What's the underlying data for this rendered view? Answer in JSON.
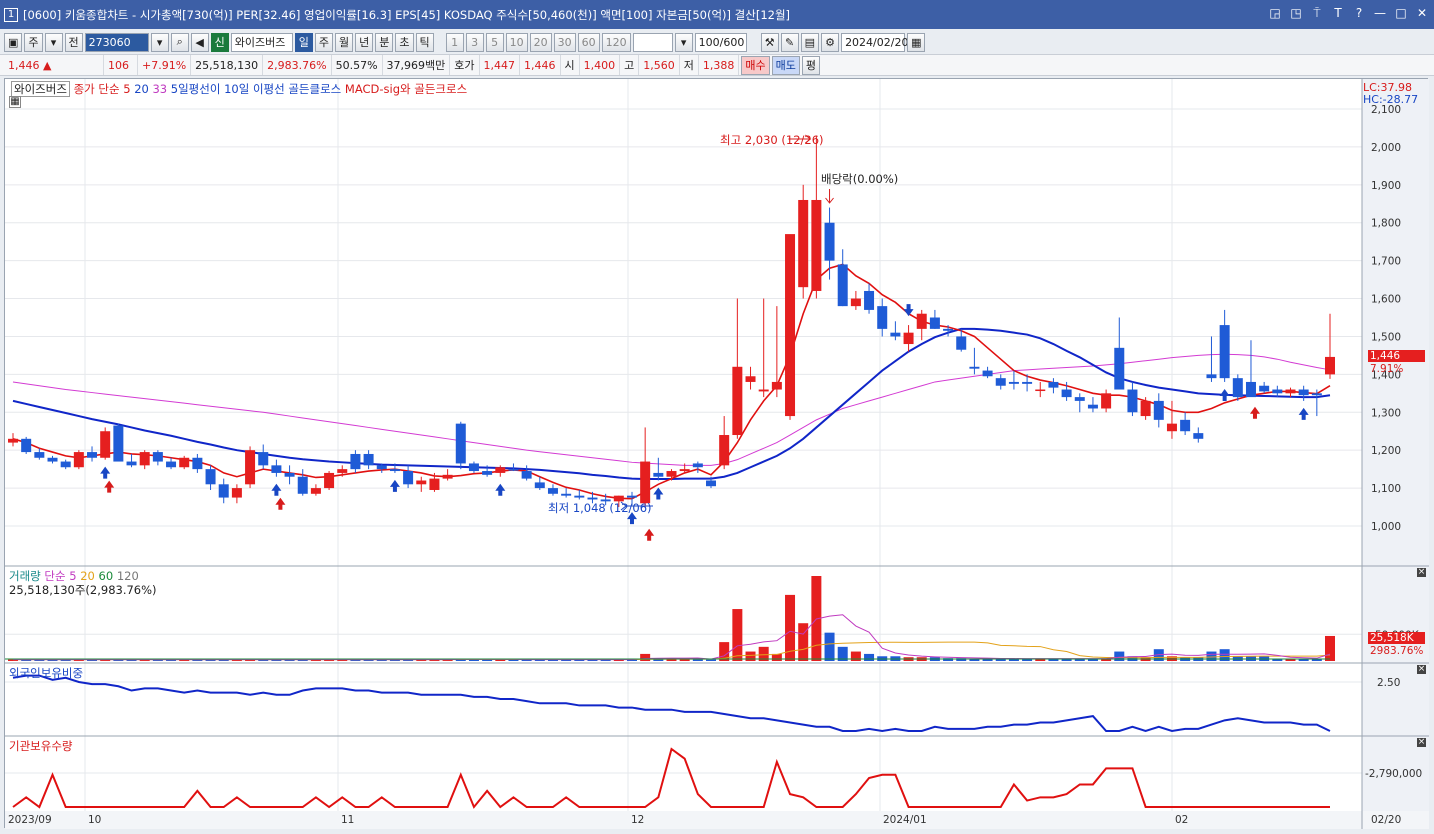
{
  "window": {
    "badge": "1",
    "title": "[0600] 키움종합차트 - 시가총액[730(억)] PER[32.46] 영업이익률[16.3] EPS[45] KOSDAQ 주식수[50,460(천)] 액면[100] 자본금[50(억)] 결산[12월]",
    "controls": [
      "◲",
      "◳",
      "⍑",
      "T",
      "?",
      "—",
      "□",
      "✕"
    ]
  },
  "toolbar": {
    "period": "주",
    "prev": "전",
    "code": "273060",
    "stock_name": "와이즈버즈",
    "new_badge": "신",
    "timeframes": [
      "일",
      "주",
      "월",
      "년",
      "분",
      "초",
      "틱"
    ],
    "selected_timeframe": "일",
    "intervals": [
      "1",
      "3",
      "5",
      "10",
      "20",
      "30",
      "60",
      "120"
    ],
    "count": "100/600",
    "date": "2024/02/20"
  },
  "quote": {
    "price": "1,446 ▲",
    "change": "106",
    "change_pct": "+7.91%",
    "volume": "25,518,130",
    "volume_pct": "2,983.76%",
    "ratio": "50.57%",
    "amount": "37,969백만",
    "ask_label": "호가",
    "ask": "1,447",
    "bid": "1,446",
    "open_label": "시",
    "open": "1,400",
    "high_label": "고",
    "high": "1,560",
    "low_label": "저",
    "low": "1,388",
    "buy_btn": "매수",
    "sell_btn": "매도",
    "eval_btn": "평"
  },
  "price_panel": {
    "legend_name": "와이즈버즈",
    "legend_ma": "종가 단순",
    "ma_periods": [
      "5",
      "20",
      "33"
    ],
    "legend_signal": "5일평선이 10일 이평선 골든클로스",
    "legend_macd": "MACD-sig와 골든크로스",
    "lc": "LC:37.98",
    "hc": "HC:-28.77",
    "max_annot": "최고 2,030 (12/26)",
    "min_annot": "최저 1,048 (12/06)",
    "div_annot": "배당락(0.00%)",
    "current_label": "1,446",
    "current_pct": "7.91%",
    "y_ticks": [
      "2,100",
      "2,000",
      "1,900",
      "1,800",
      "1,700",
      "1,600",
      "1,500",
      "1,400",
      "1,300",
      "1,200",
      "1,100",
      "1,000"
    ]
  },
  "volume_panel": {
    "title": "거래량",
    "ma_label": "단순",
    "ma_periods": [
      "5",
      "20",
      "60",
      "120"
    ],
    "info": "25,518,130주(2,983.76%)",
    "tick": "50,000K",
    "current_label": "25,518K",
    "current_pct": "2983.76%"
  },
  "foreign_panel": {
    "title": "외국인보유비중",
    "tick": "2.50"
  },
  "inst_panel": {
    "title": "기관보유수량",
    "tick": "-2,790,000"
  },
  "x_axis": [
    "2023/09",
    "10",
    "11",
    "12",
    "2024/01",
    "02",
    "02/20"
  ],
  "chart_data": {
    "type": "candlestick",
    "candles": [
      [
        1220,
        1245,
        1210,
        1230
      ],
      [
        1230,
        1235,
        1190,
        1195
      ],
      [
        1195,
        1205,
        1175,
        1180
      ],
      [
        1180,
        1185,
        1165,
        1170
      ],
      [
        1170,
        1175,
        1150,
        1155
      ],
      [
        1155,
        1200,
        1150,
        1195
      ],
      [
        1195,
        1210,
        1170,
        1180
      ],
      [
        1180,
        1260,
        1175,
        1250
      ],
      [
        1265,
        1270,
        1175,
        1170
      ],
      [
        1170,
        1190,
        1155,
        1160
      ],
      [
        1160,
        1200,
        1150,
        1195
      ],
      [
        1195,
        1200,
        1160,
        1170
      ],
      [
        1170,
        1180,
        1150,
        1155
      ],
      [
        1155,
        1185,
        1150,
        1180
      ],
      [
        1180,
        1190,
        1140,
        1150
      ],
      [
        1150,
        1160,
        1095,
        1110
      ],
      [
        1110,
        1125,
        1060,
        1075
      ],
      [
        1075,
        1110,
        1060,
        1100
      ],
      [
        1110,
        1210,
        1100,
        1200
      ],
      [
        1195,
        1215,
        1150,
        1160
      ],
      [
        1160,
        1175,
        1130,
        1140
      ],
      [
        1140,
        1160,
        1110,
        1130
      ],
      [
        1130,
        1150,
        1080,
        1085
      ],
      [
        1085,
        1110,
        1080,
        1100
      ],
      [
        1100,
        1145,
        1095,
        1140
      ],
      [
        1140,
        1160,
        1130,
        1150
      ],
      [
        1190,
        1200,
        1140,
        1150
      ],
      [
        1190,
        1200,
        1150,
        1160
      ],
      [
        1160,
        1165,
        1140,
        1150
      ],
      [
        1150,
        1165,
        1140,
        1145
      ],
      [
        1145,
        1160,
        1100,
        1110
      ],
      [
        1110,
        1130,
        1090,
        1120
      ],
      [
        1095,
        1140,
        1090,
        1125
      ],
      [
        1125,
        1150,
        1120,
        1135
      ],
      [
        1270,
        1275,
        1150,
        1165
      ],
      [
        1165,
        1170,
        1140,
        1145
      ],
      [
        1145,
        1160,
        1130,
        1135
      ],
      [
        1140,
        1160,
        1130,
        1155
      ],
      [
        1150,
        1165,
        1145,
        1148
      ],
      [
        1145,
        1160,
        1120,
        1125
      ],
      [
        1115,
        1130,
        1095,
        1100
      ],
      [
        1100,
        1110,
        1080,
        1085
      ],
      [
        1085,
        1100,
        1075,
        1080
      ],
      [
        1080,
        1095,
        1070,
        1075
      ],
      [
        1075,
        1090,
        1060,
        1070
      ],
      [
        1070,
        1085,
        1055,
        1065
      ],
      [
        1065,
        1080,
        1050,
        1080
      ],
      [
        1080,
        1090,
        1055,
        1075
      ],
      [
        1060,
        1260,
        1048,
        1170
      ],
      [
        1140,
        1180,
        1120,
        1130
      ],
      [
        1130,
        1150,
        1120,
        1145
      ],
      [
        1145,
        1165,
        1140,
        1150
      ],
      [
        1165,
        1170,
        1140,
        1155
      ],
      [
        1120,
        1130,
        1100,
        1105
      ],
      [
        1160,
        1290,
        1150,
        1240
      ],
      [
        1240,
        1600,
        1230,
        1420
      ],
      [
        1380,
        1420,
        1360,
        1395
      ],
      [
        1355,
        1600,
        1340,
        1360
      ],
      [
        1360,
        1580,
        1340,
        1380
      ],
      [
        1290,
        1680,
        1280,
        1770
      ],
      [
        1630,
        1900,
        1600,
        1860
      ],
      [
        1620,
        2030,
        1600,
        1860
      ],
      [
        1800,
        1840,
        1650,
        1700
      ],
      [
        1690,
        1730,
        1580,
        1580
      ],
      [
        1580,
        1620,
        1570,
        1600
      ],
      [
        1620,
        1640,
        1560,
        1570
      ],
      [
        1580,
        1600,
        1500,
        1520
      ],
      [
        1510,
        1540,
        1490,
        1500
      ],
      [
        1480,
        1530,
        1460,
        1510
      ],
      [
        1520,
        1570,
        1490,
        1560
      ],
      [
        1550,
        1570,
        1520,
        1520
      ],
      [
        1520,
        1530,
        1500,
        1515
      ],
      [
        1500,
        1520,
        1460,
        1465
      ],
      [
        1420,
        1470,
        1400,
        1415
      ],
      [
        1410,
        1420,
        1390,
        1395
      ],
      [
        1390,
        1400,
        1360,
        1370
      ],
      [
        1380,
        1410,
        1360,
        1375
      ],
      [
        1380,
        1400,
        1355,
        1375
      ],
      [
        1360,
        1380,
        1340,
        1360
      ],
      [
        1380,
        1390,
        1350,
        1365
      ],
      [
        1360,
        1380,
        1330,
        1340
      ],
      [
        1340,
        1350,
        1300,
        1330
      ],
      [
        1320,
        1340,
        1300,
        1310
      ],
      [
        1310,
        1360,
        1300,
        1350
      ],
      [
        1470,
        1550,
        1440,
        1360
      ],
      [
        1360,
        1380,
        1290,
        1300
      ],
      [
        1290,
        1340,
        1280,
        1330
      ],
      [
        1330,
        1350,
        1260,
        1280
      ],
      [
        1250,
        1330,
        1230,
        1270
      ],
      [
        1280,
        1300,
        1240,
        1250
      ],
      [
        1245,
        1260,
        1220,
        1230
      ],
      [
        1400,
        1500,
        1380,
        1390
      ],
      [
        1530,
        1570,
        1380,
        1390
      ],
      [
        1390,
        1400,
        1330,
        1340
      ],
      [
        1380,
        1490,
        1370,
        1340
      ],
      [
        1370,
        1380,
        1350,
        1355
      ],
      [
        1360,
        1370,
        1340,
        1350
      ],
      [
        1350,
        1365,
        1340,
        1360
      ],
      [
        1360,
        1370,
        1330,
        1345
      ],
      [
        1350,
        1360,
        1290,
        1345
      ],
      [
        1400,
        1560,
        1388,
        1446
      ]
    ],
    "ma5": [
      1230,
      1220,
      1205,
      1195,
      1185,
      1180,
      1185,
      1190,
      1195,
      1190,
      1188,
      1185,
      1180,
      1175,
      1170,
      1160,
      1140,
      1130,
      1140,
      1150,
      1145,
      1140,
      1135,
      1128,
      1130,
      1135,
      1140,
      1145,
      1148,
      1150,
      1145,
      1140,
      1132,
      1130,
      1133,
      1138,
      1140,
      1145,
      1148,
      1145,
      1130,
      1115,
      1102,
      1095,
      1085,
      1078,
      1073,
      1072,
      1090,
      1110,
      1125,
      1140,
      1150,
      1135,
      1170,
      1220,
      1280,
      1330,
      1370,
      1450,
      1560,
      1650,
      1680,
      1690,
      1660,
      1640,
      1610,
      1590,
      1560,
      1540,
      1530,
      1525,
      1515,
      1500,
      1470,
      1440,
      1410,
      1395,
      1385,
      1378,
      1370,
      1360,
      1350,
      1345,
      1345,
      1340,
      1330,
      1320,
      1305,
      1300,
      1300,
      1310,
      1325,
      1335,
      1345,
      1350,
      1355,
      1355,
      1352,
      1349,
      1370
    ],
    "ma20": [
      1330,
      1322,
      1314,
      1306,
      1298,
      1290,
      1282,
      1275,
      1268,
      1260,
      1252,
      1245,
      1238,
      1230,
      1222,
      1215,
      1207,
      1200,
      1195,
      1190,
      1185,
      1180,
      1176,
      1173,
      1170,
      1168,
      1166,
      1164,
      1162,
      1161,
      1160,
      1159,
      1158,
      1157,
      1156,
      1155,
      1154,
      1153,
      1152,
      1150,
      1148,
      1145,
      1142,
      1139,
      1135,
      1132,
      1128,
      1125,
      1124,
      1124,
      1124,
      1125,
      1125,
      1125,
      1130,
      1140,
      1155,
      1170,
      1185,
      1205,
      1230,
      1260,
      1290,
      1320,
      1350,
      1380,
      1410,
      1435,
      1460,
      1480,
      1498,
      1510,
      1520,
      1520,
      1518,
      1515,
      1510,
      1505,
      1495,
      1480,
      1462,
      1445,
      1425,
      1405,
      1390,
      1380,
      1372,
      1365,
      1360,
      1355,
      1350,
      1348,
      1346,
      1345,
      1344,
      1343,
      1342,
      1341,
      1340,
      1340,
      1345
    ],
    "ma33": [
      1380,
      1375,
      1370,
      1365,
      1360,
      1356,
      1352,
      1348,
      1344,
      1340,
      1336,
      1332,
      1328,
      1324,
      1320,
      1316,
      1312,
      1308,
      1304,
      1300,
      1295,
      1290,
      1285,
      1280,
      1275,
      1270,
      1265,
      1260,
      1255,
      1250,
      1245,
      1240,
      1235,
      1230,
      1225,
      1220,
      1215,
      1210,
      1205,
      1200,
      1196,
      1192,
      1188,
      1184,
      1180,
      1176,
      1172,
      1168,
      1166,
      1164,
      1162,
      1160,
      1160,
      1160,
      1165,
      1175,
      1190,
      1205,
      1220,
      1240,
      1260,
      1280,
      1295,
      1310,
      1320,
      1330,
      1340,
      1350,
      1360,
      1370,
      1380,
      1385,
      1390,
      1395,
      1400,
      1405,
      1410,
      1412,
      1414,
      1416,
      1418,
      1420,
      1422,
      1425,
      1428,
      1432,
      1436,
      1440,
      1444,
      1447,
      1450,
      1452,
      1453,
      1452,
      1450,
      1446,
      1440,
      1432,
      1425,
      1418,
      1412
    ],
    "volume": [
      0.3,
      0.3,
      0.3,
      0.3,
      0.3,
      0.3,
      0.3,
      0.3,
      0.3,
      0.3,
      0.3,
      0.3,
      0.3,
      0.3,
      0.3,
      0.3,
      0.3,
      0.3,
      0.3,
      0.3,
      0.3,
      0.3,
      0.3,
      0.3,
      0.3,
      0.3,
      0.3,
      0.3,
      0.3,
      0.3,
      0.3,
      0.3,
      0.3,
      0.3,
      0.5,
      0.3,
      0.3,
      0.3,
      0.3,
      0.3,
      0.3,
      0.3,
      0.3,
      0.3,
      0.3,
      0.3,
      0.3,
      0.3,
      1.5,
      0.5,
      0.4,
      0.4,
      0.4,
      0.3,
      4,
      11,
      2,
      3,
      1.5,
      14,
      8,
      18,
      6,
      3,
      2,
      1.5,
      1,
      1,
      0.8,
      0.8,
      0.8,
      0.6,
      0.6,
      0.5,
      0.5,
      0.5,
      0.5,
      0.5,
      0.5,
      0.5,
      0.5,
      0.5,
      0.5,
      0.5,
      2,
      1,
      0.8,
      2.5,
      1,
      0.8,
      0.8,
      2,
      2.5,
      1,
      1,
      1,
      0.5,
      0.5,
      0.5,
      0.5,
      5.3
    ],
    "foreign": [
      2.52,
      2.53,
      2.53,
      2.51,
      2.52,
      2.5,
      2.49,
      2.49,
      2.48,
      2.46,
      2.47,
      2.47,
      2.46,
      2.45,
      2.46,
      2.45,
      2.45,
      2.45,
      2.44,
      2.45,
      2.44,
      2.44,
      2.46,
      2.47,
      2.47,
      2.47,
      2.46,
      2.46,
      2.45,
      2.45,
      2.45,
      2.44,
      2.44,
      2.44,
      2.44,
      2.43,
      2.43,
      2.42,
      2.42,
      2.41,
      2.4,
      2.4,
      2.4,
      2.39,
      2.39,
      2.39,
      2.38,
      2.38,
      2.37,
      2.37,
      2.37,
      2.36,
      2.36,
      2.36,
      2.35,
      2.34,
      2.33,
      2.33,
      2.32,
      2.31,
      2.3,
      2.29,
      2.29,
      2.27,
      2.27,
      2.28,
      2.27,
      2.28,
      2.27,
      2.27,
      2.29,
      2.28,
      2.28,
      2.28,
      2.29,
      2.29,
      2.3,
      2.3,
      2.31,
      2.31,
      2.32,
      2.33,
      2.34,
      2.27,
      2.27,
      2.29,
      2.27,
      2.29,
      2.27,
      2.28,
      2.28,
      2.3,
      2.32,
      2.33,
      2.32,
      2.31,
      2.31,
      2.31,
      2.3,
      2.3,
      2.27
    ],
    "inst": [
      0,
      0.3,
      0,
      1,
      0,
      0,
      0,
      0,
      0,
      0,
      0,
      0,
      0,
      0,
      0.5,
      0,
      0,
      0.3,
      0,
      0,
      0,
      0,
      0,
      0.3,
      0,
      0.3,
      0,
      0,
      0.3,
      0,
      0,
      0,
      0,
      0,
      1,
      0,
      0.5,
      0,
      0.3,
      0,
      0,
      0,
      0.3,
      0,
      0,
      0,
      0,
      0,
      0,
      0.3,
      1.8,
      1.5,
      0.4,
      0,
      0,
      0,
      0,
      0,
      1.4,
      0.4,
      0.3,
      0,
      0,
      0,
      0.4,
      0.9,
      1,
      1,
      0,
      0,
      0,
      0,
      0,
      0,
      0,
      0,
      0.7,
      0.2,
      0.3,
      0.3,
      0.4,
      0.7,
      0.7,
      1.2,
      1.2,
      1.2,
      0,
      0,
      0,
      0,
      0,
      0,
      0,
      0,
      0,
      0,
      0,
      0,
      0,
      0,
      0
    ],
    "up_arrows": [
      7,
      20,
      29,
      37,
      47,
      49,
      92,
      98
    ],
    "down_arrows": [
      68
    ],
    "buy_arrows": [
      7,
      20,
      48,
      94
    ]
  }
}
